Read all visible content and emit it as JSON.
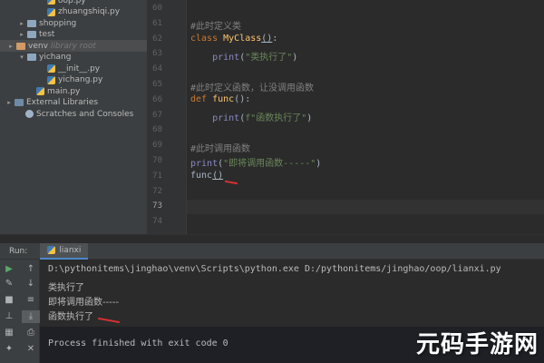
{
  "project": {
    "items": [
      {
        "label": "oop.py",
        "kind": "py",
        "indent": 42,
        "arrow": ""
      },
      {
        "label": "zhuangshiqi.py",
        "kind": "py",
        "indent": 42,
        "arrow": ""
      },
      {
        "label": "shopping",
        "kind": "folder",
        "indent": 20,
        "arrow": "▸"
      },
      {
        "label": "test",
        "kind": "folder",
        "indent": 20,
        "arrow": "▸"
      },
      {
        "label": "venv",
        "kind": "venv",
        "indent": 8,
        "arrow": "▸",
        "hint": "library root"
      },
      {
        "label": "yichang",
        "kind": "folder",
        "indent": 20,
        "arrow": "▾"
      },
      {
        "label": "__init__.py",
        "kind": "py",
        "indent": 42,
        "arrow": ""
      },
      {
        "label": "yichang.py",
        "kind": "py",
        "indent": 42,
        "arrow": ""
      },
      {
        "label": "main.py",
        "kind": "py",
        "indent": 30,
        "arrow": ""
      },
      {
        "label": "External Libraries",
        "kind": "libs",
        "indent": 6,
        "arrow": "▸"
      },
      {
        "label": "Scratches and Consoles",
        "kind": "scratch",
        "indent": 18,
        "arrow": ""
      }
    ]
  },
  "editor": {
    "line_numbers": [
      "60",
      "61",
      "62",
      "63",
      "64",
      "65",
      "66",
      "67",
      "68",
      "69",
      "70",
      "71",
      "72",
      "73",
      "74"
    ],
    "current_line": "73",
    "code": {
      "l61_comment": "#此时定义类",
      "l62_kw": "class ",
      "l62_name": "MyClass",
      "l62_paren": "()",
      "l62_colon": ":",
      "l63_print": "print",
      "l63_str": "\"类执行了\"",
      "l65_comment": "#此时定义函数，让没调用函数",
      "l66_kw": "def ",
      "l66_name": "func",
      "l66_rest": "():",
      "l67_print": "print",
      "l67_str": "f\"函数执行了\"",
      "l69_comment": "#此时调用函数",
      "l70_print": "print",
      "l70_str": "\"即将调用函数-----\"",
      "l71_call": "func",
      "l71_paren": "()"
    }
  },
  "run": {
    "label": "Run:",
    "tab": "lianxi",
    "console": {
      "command": "D:\\pythonitems\\jinghao\\venv\\Scripts\\python.exe D:/pythonitems/jinghao/oop/lianxi.py",
      "out1": "类执行了",
      "out2": "即将调用函数-----",
      "out3": "函数执行了",
      "finish": "Process finished with exit code 0"
    },
    "toolbar_icons": [
      "play-icon",
      "wrench-icon",
      "stop-icon",
      "pin-icon",
      "layout-icon",
      "pin2-icon"
    ],
    "toolbar2_icons": [
      "up-icon",
      "down-icon",
      "soft-wrap-icon",
      "scroll-end-icon",
      "print-icon",
      "trash-icon"
    ]
  },
  "watermark": {
    "text": "元码手游网"
  },
  "colors": {
    "accent_tab": "#4a88c7",
    "annotation_red": "#d63030"
  }
}
